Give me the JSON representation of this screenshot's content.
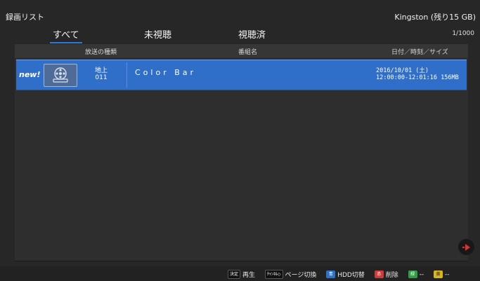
{
  "header": {
    "title": "録画リスト",
    "storage": "Kingston  (残り15 GB)"
  },
  "tabs": [
    {
      "label": "すべて",
      "active": true
    },
    {
      "label": "未視聴",
      "active": false
    },
    {
      "label": "視聴済",
      "active": false
    }
  ],
  "page_count": "1/1000",
  "columns": {
    "broadcast_type": "放送の種類",
    "program_name": "番組名",
    "datetime_size": "日付／時刻／サイズ"
  },
  "recordings": [
    {
      "new_badge": "new!",
      "broadcast_type": "地上",
      "channel": "011",
      "program_name": "Color Bar",
      "date": "2016/10/01 (土)",
      "time_size": "12:00:00-12:01:16  156MB",
      "thumbnail_icon": "film-reel-icon",
      "selected": true
    }
  ],
  "footer": {
    "keys": [
      {
        "chip": "決定",
        "label": "再生",
        "color": "black"
      },
      {
        "chip": "ﾁｬﾝﾈﾙ◇",
        "label": "ページ切換",
        "color": "black"
      },
      {
        "chip": "青",
        "label": "HDD切替",
        "color": "#2a73c8"
      },
      {
        "chip": "赤",
        "label": "削除",
        "color": "#d03a3a"
      },
      {
        "chip": "緑",
        "label": "--",
        "color": "#2f9e44"
      },
      {
        "chip": "黄",
        "label": "--",
        "color": "#d8b61a"
      }
    ]
  },
  "colors": {
    "accent": "#2a7bd4",
    "selected_row": "#2f6ec9",
    "background": "#272727"
  }
}
